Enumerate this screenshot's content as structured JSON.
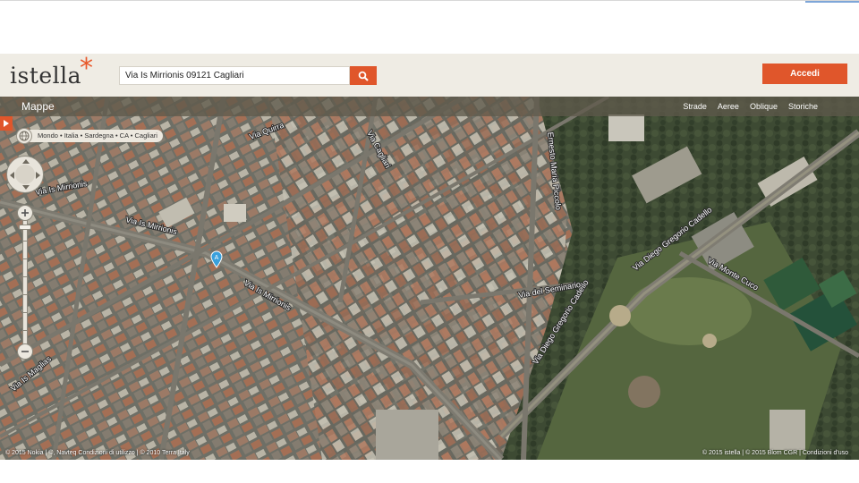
{
  "brand": {
    "name": "istella",
    "accent": "#e0562b",
    "symbol": "*"
  },
  "search": {
    "value": "Via Is Mirrionis 09121 Cagliari",
    "placeholder": "",
    "button_icon": "search-icon"
  },
  "header": {
    "login_label": "Accedi"
  },
  "map": {
    "title": "Mappe",
    "view_tabs": [
      "Strade",
      "Aeree",
      "Oblique",
      "Storiche"
    ],
    "breadcrumb": "Mondo • Italia • Sardegna • CA • Cagliari",
    "marker_label": "A",
    "street_labels": [
      "Via Is Mirrionis",
      "Via Is Mirrionis",
      "Via Is Mirrionis",
      "Via Diego Gregorio Cadello",
      "Via Diego Gregorio Cadello",
      "Via del Seminario",
      "Via Monte Cuco",
      "Via Quirra",
      "Via Cagliari",
      "Ernesto Maria Piccolo",
      "Via Is Maglias"
    ],
    "attribution_left": "© 2015 Nokia | ©, Navteq Condizioni di utilizzo | © 2010 Terra Italy",
    "attribution_right": "© 2015 istella | © 2015 Blom CGR | Condizioni d'uso"
  },
  "colors": {
    "header_bg": "#efece4",
    "map_bar": "#5f5a4b",
    "marker": "#3aa0dc"
  }
}
